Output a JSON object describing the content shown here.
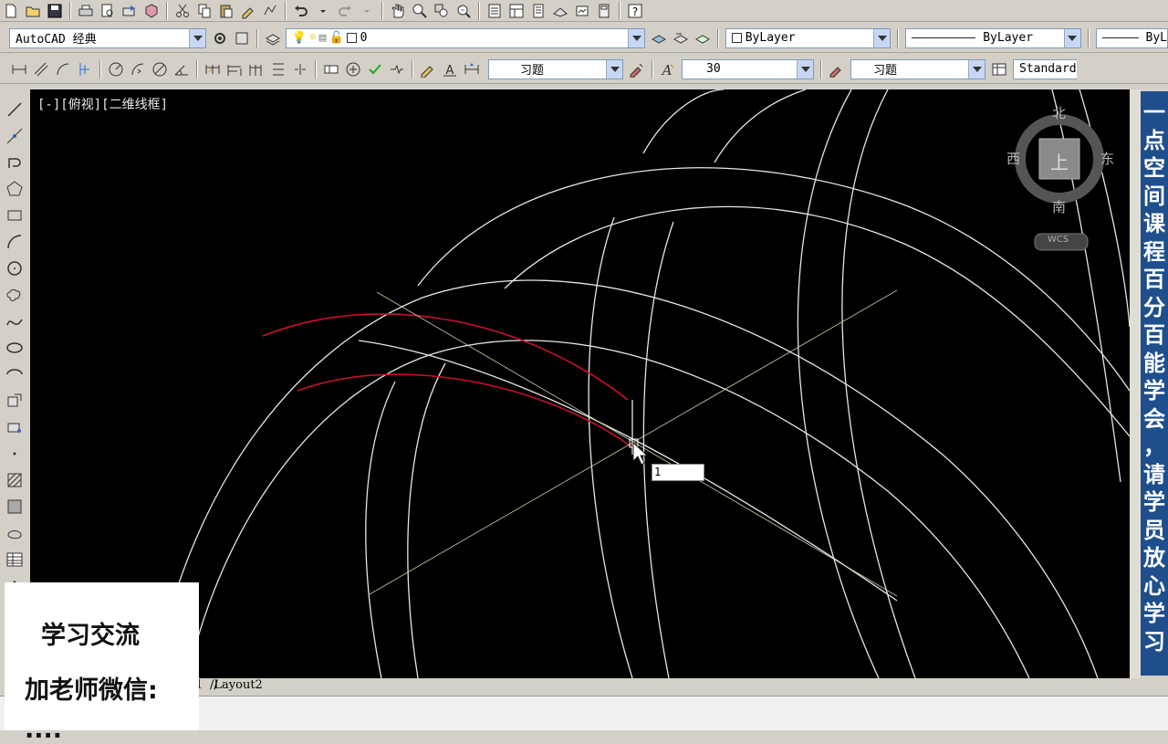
{
  "workspace": {
    "value": "AutoCAD 经典"
  },
  "layer": {
    "value": "0"
  },
  "color": {
    "value": "ByLayer"
  },
  "linetype": {
    "value": "ByLayer"
  },
  "lineweight": {
    "value": "ByL"
  },
  "dimstyle": {
    "value": "习题"
  },
  "text_height": {
    "value": "30"
  },
  "textstyle": {
    "value": "习题"
  },
  "tablestyle": {
    "value": "Standard"
  },
  "viewport": {
    "label": "[-][俯视][二维线框]"
  },
  "viewcube": {
    "north": "北",
    "south": "南",
    "east": "东",
    "west": "西",
    "face": "上",
    "ucs": "WCS"
  },
  "dynamic_input": {
    "value": "1"
  },
  "layout_tabs": {
    "model_tail": "1",
    "layout2": "Layout2"
  },
  "promo_banner": {
    "chars": [
      "一",
      "点",
      "空",
      "间",
      "课",
      "程",
      "百",
      "分",
      "百",
      "能",
      "学",
      "会",
      "，",
      "请",
      "学",
      "员",
      "放",
      "心",
      "学",
      "习"
    ]
  },
  "wechat_box": {
    "line1": "学习交流",
    "line2": "加老师微信:",
    "line3": "...."
  },
  "colors": {
    "canvas": "#000000",
    "geometry": "#e6e6e6",
    "selected": "#c8102e",
    "construction": "#d8d0b0",
    "banner": "#1e4f8c"
  }
}
